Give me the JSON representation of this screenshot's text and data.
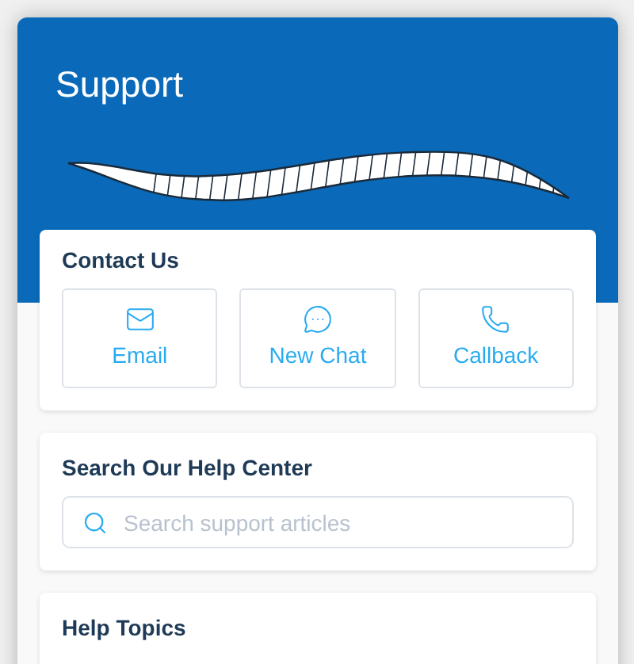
{
  "header": {
    "title": "Support"
  },
  "contact": {
    "title": "Contact Us",
    "options": [
      {
        "kind": "email",
        "label": "Email"
      },
      {
        "kind": "chat",
        "label": "New Chat"
      },
      {
        "kind": "phone",
        "label": "Callback"
      }
    ]
  },
  "search": {
    "title": "Search Our Help Center",
    "placeholder": "Search support articles"
  },
  "topics": {
    "title": "Help Topics"
  }
}
